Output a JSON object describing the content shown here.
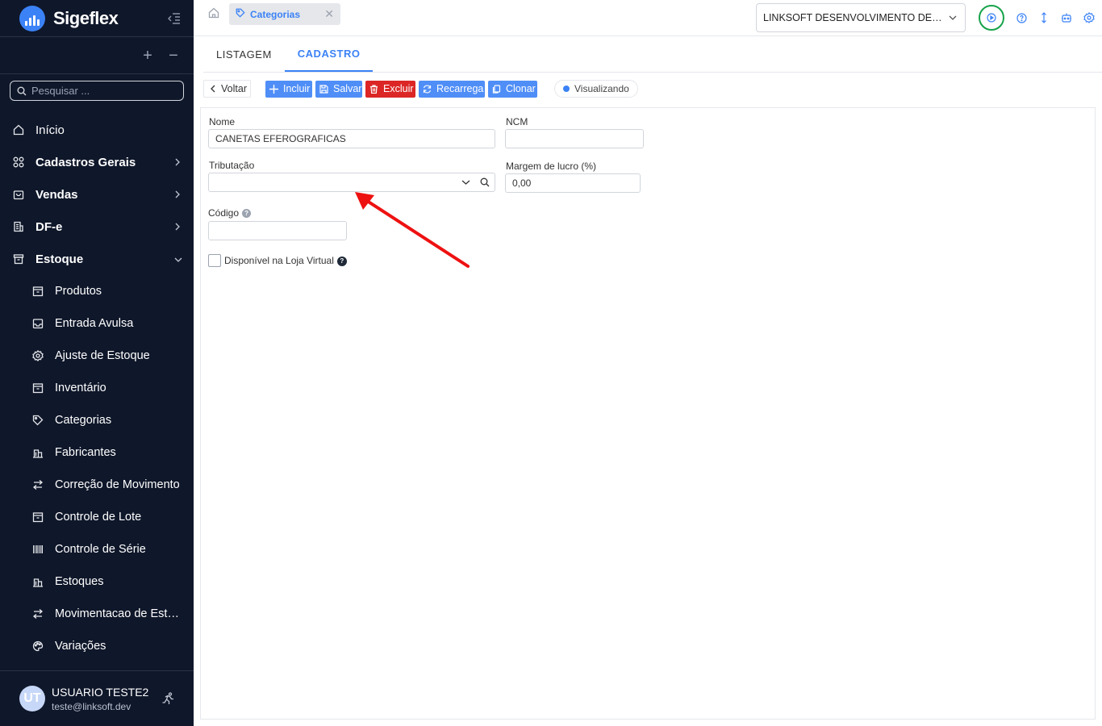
{
  "app": {
    "name": "Sigeflex"
  },
  "sidebar": {
    "search_placeholder": "Pesquisar ...",
    "tools": {
      "expand": "+",
      "collapse": "−"
    },
    "items": [
      {
        "label": "Início",
        "icon": "home-icon"
      },
      {
        "label": "Cadastros Gerais",
        "icon": "grid-icon"
      },
      {
        "label": "Vendas",
        "icon": "shopping-bag-icon"
      },
      {
        "label": "DF-e",
        "icon": "document-icon"
      },
      {
        "label": "Estoque",
        "icon": "archive-icon"
      }
    ],
    "subitems": [
      {
        "label": "Produtos",
        "icon": "archive-icon"
      },
      {
        "label": "Entrada Avulsa",
        "icon": "inbox-icon"
      },
      {
        "label": "Ajuste de Estoque",
        "icon": "gear-icon"
      },
      {
        "label": "Inventário",
        "icon": "archive-icon"
      },
      {
        "label": "Categorias",
        "icon": "tag-icon"
      },
      {
        "label": "Fabricantes",
        "icon": "building-icon"
      },
      {
        "label": "Correção de Movimento",
        "icon": "swap-icon"
      },
      {
        "label": "Controle de Lote",
        "icon": "archive-icon"
      },
      {
        "label": "Controle de Série",
        "icon": "barcode-icon"
      },
      {
        "label": "Estoques",
        "icon": "building-icon"
      },
      {
        "label": "Movimentacao de Estoque",
        "icon": "swap-icon"
      },
      {
        "label": "Variações",
        "icon": "palette-icon"
      }
    ],
    "user": {
      "initials": "UT",
      "name": "USUARIO TESTE2",
      "email": "teste@linksoft.dev"
    }
  },
  "topbar": {
    "open_tab": "Categorias",
    "company": "LINKSOFT DESENVOLVIMENTO DE SOFTWARE",
    "icons": [
      "play-icon",
      "help-icon",
      "sort-icon",
      "robot-icon",
      "gear-icon"
    ]
  },
  "main": {
    "tabs": [
      {
        "label": "LISTAGEM"
      },
      {
        "label": "CADASTRO"
      }
    ],
    "toolbar": {
      "back": "Voltar",
      "include": "Incluir",
      "save": "Salvar",
      "delete": "Excluir",
      "reload": "Recarrega",
      "clone": "Clonar",
      "status": "Visualizando"
    },
    "form": {
      "nome_label": "Nome",
      "nome_value": "CANETAS EFEROGRAFICAS",
      "ncm_label": "NCM",
      "ncm_value": "",
      "tributacao_label": "Tributação",
      "tributacao_value": "",
      "margem_label": "Margem de lucro (%)",
      "margem_value": "0,00",
      "codigo_label": "Código",
      "codigo_value": "",
      "loja_label": "Disponível na Loja Virtual"
    }
  },
  "colors": {
    "sidebar_bg": "#0f172a",
    "accent": "#3b82f6",
    "danger": "#dc2626",
    "arrow": "#ee1111",
    "ring": "#16a34a"
  }
}
